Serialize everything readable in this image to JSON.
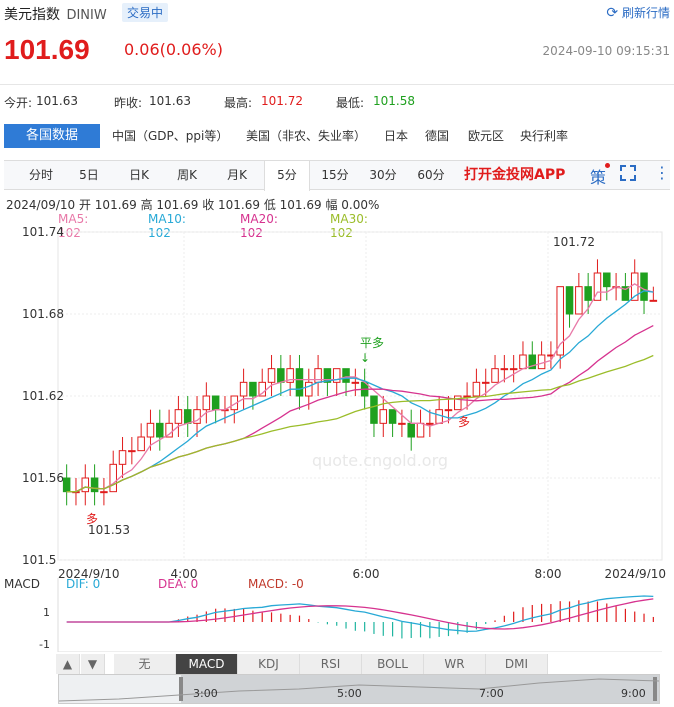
{
  "header": {
    "title": "美元指数",
    "code": "DINIW",
    "status": "交易中",
    "refresh_label": "刷新行情"
  },
  "quote": {
    "price": "101.69",
    "change": "0.06(0.06%)",
    "datetime": "2024-09-10 09:15:31"
  },
  "stats": {
    "open_label": "今开:",
    "open": "101.63",
    "prev_label": "昨收:",
    "prev": "101.63",
    "high_label": "最高:",
    "high": "101.72",
    "low_label": "最低:",
    "low": "101.58"
  },
  "data_tabs": {
    "active": "各国数据",
    "items": [
      "中国（GDP、ppi等）",
      "美国（非农、失业率）",
      "日本",
      "德国",
      "欧元区",
      "央行利率"
    ]
  },
  "period_tabs": {
    "items": [
      "分时",
      "5日",
      "日K",
      "周K",
      "月K",
      "5分",
      "15分",
      "30分",
      "60分"
    ],
    "active_index": 5,
    "app_link": "打开金投网APP",
    "ce_label": "策"
  },
  "info_line": "2024/09/10  开 101.69  高 101.69  收 101.69  低 101.69  幅 0.00%",
  "ma_legend": [
    {
      "label": "MA5: 102",
      "color": "#e879a8"
    },
    {
      "label": "MA10: 102",
      "color": "#28a9d6"
    },
    {
      "label": "MA20: 102",
      "color": "#d6338f"
    },
    {
      "label": "MA30: 102",
      "color": "#9bbd2a"
    }
  ],
  "watermark": "quote.cngold.org",
  "annotations": {
    "high_label": "101.72",
    "low_label": "101.53",
    "flat_long": "平多",
    "long1": "多",
    "long2": "多"
  },
  "macd": {
    "label": "MACD",
    "dif": "DIF: 0",
    "dea": "DEA: 0",
    "macd": "MACD: -0",
    "ticks": [
      "1",
      "-1"
    ]
  },
  "bottom_tabs": {
    "up": "▲",
    "down": "▼",
    "items": [
      "无",
      "MACD",
      "KDJ",
      "RSI",
      "BOLL",
      "WR",
      "DMI"
    ],
    "active_index": 1
  },
  "navigator": {
    "ticks": [
      "3:00",
      "5:00",
      "7:00",
      "9:00"
    ]
  },
  "colors": {
    "up": "#e01c1c",
    "down": "#1fa01f",
    "accent": "#2f7bd6"
  },
  "chart_data": {
    "type": "candlestick",
    "y_ticks": [
      "101.74",
      "101.68",
      "101.62",
      "101.56",
      "101.5"
    ],
    "ylim": [
      101.5,
      101.74
    ],
    "x_ticks": [
      "2024/9/10",
      "4:00",
      "6:00",
      "8:00",
      "2024/9/10"
    ],
    "candles": [
      [
        101.56,
        101.55,
        101.57,
        101.54
      ],
      [
        101.55,
        101.55,
        101.56,
        101.54
      ],
      [
        101.55,
        101.56,
        101.57,
        101.54
      ],
      [
        101.56,
        101.55,
        101.57,
        101.54
      ],
      [
        101.55,
        101.55,
        101.56,
        101.54
      ],
      [
        101.55,
        101.57,
        101.58,
        101.55
      ],
      [
        101.57,
        101.58,
        101.59,
        101.56
      ],
      [
        101.58,
        101.58,
        101.59,
        101.57
      ],
      [
        101.58,
        101.59,
        101.6,
        101.58
      ],
      [
        101.59,
        101.6,
        101.61,
        101.58
      ],
      [
        101.6,
        101.59,
        101.61,
        101.58
      ],
      [
        101.59,
        101.6,
        101.61,
        101.59
      ],
      [
        101.6,
        101.61,
        101.62,
        101.59
      ],
      [
        101.61,
        101.6,
        101.62,
        101.59
      ],
      [
        101.6,
        101.61,
        101.62,
        101.59
      ],
      [
        101.61,
        101.62,
        101.63,
        101.6
      ],
      [
        101.62,
        101.61,
        101.62,
        101.6
      ],
      [
        101.61,
        101.61,
        101.62,
        101.6
      ],
      [
        101.61,
        101.62,
        101.62,
        101.6
      ],
      [
        101.62,
        101.63,
        101.64,
        101.61
      ],
      [
        101.63,
        101.62,
        101.63,
        101.61
      ],
      [
        101.62,
        101.63,
        101.64,
        101.62
      ],
      [
        101.63,
        101.64,
        101.65,
        101.62
      ],
      [
        101.64,
        101.63,
        101.65,
        101.62
      ],
      [
        101.63,
        101.64,
        101.65,
        101.62
      ],
      [
        101.64,
        101.62,
        101.65,
        101.61
      ],
      [
        101.62,
        101.63,
        101.64,
        101.61
      ],
      [
        101.63,
        101.64,
        101.65,
        101.62
      ],
      [
        101.64,
        101.63,
        101.64,
        101.62
      ],
      [
        101.63,
        101.64,
        101.64,
        101.62
      ],
      [
        101.64,
        101.63,
        101.64,
        101.62
      ],
      [
        101.63,
        101.63,
        101.64,
        101.62
      ],
      [
        101.63,
        101.62,
        101.64,
        101.61
      ],
      [
        101.62,
        101.6,
        101.62,
        101.59
      ],
      [
        101.6,
        101.61,
        101.62,
        101.59
      ],
      [
        101.61,
        101.6,
        101.61,
        101.59
      ],
      [
        101.6,
        101.6,
        101.61,
        101.59
      ],
      [
        101.6,
        101.59,
        101.61,
        101.58
      ],
      [
        101.59,
        101.6,
        101.61,
        101.59
      ],
      [
        101.6,
        101.6,
        101.61,
        101.59
      ],
      [
        101.6,
        101.61,
        101.62,
        101.6
      ],
      [
        101.61,
        101.61,
        101.62,
        101.6
      ],
      [
        101.61,
        101.62,
        101.62,
        101.61
      ],
      [
        101.62,
        101.62,
        101.63,
        101.61
      ],
      [
        101.62,
        101.63,
        101.64,
        101.62
      ],
      [
        101.63,
        101.63,
        101.64,
        101.62
      ],
      [
        101.63,
        101.64,
        101.65,
        101.63
      ],
      [
        101.64,
        101.64,
        101.65,
        101.63
      ],
      [
        101.64,
        101.64,
        101.65,
        101.63
      ],
      [
        101.64,
        101.65,
        101.66,
        101.64
      ],
      [
        101.65,
        101.64,
        101.66,
        101.64
      ],
      [
        101.64,
        101.65,
        101.66,
        101.64
      ],
      [
        101.65,
        101.65,
        101.66,
        101.64
      ],
      [
        101.65,
        101.7,
        101.7,
        101.64
      ],
      [
        101.7,
        101.68,
        101.7,
        101.67
      ],
      [
        101.68,
        101.7,
        101.71,
        101.68
      ],
      [
        101.7,
        101.69,
        101.71,
        101.68
      ],
      [
        101.69,
        101.71,
        101.72,
        101.69
      ],
      [
        101.71,
        101.7,
        101.71,
        101.69
      ],
      [
        101.7,
        101.7,
        101.71,
        101.69
      ],
      [
        101.7,
        101.69,
        101.71,
        101.69
      ],
      [
        101.69,
        101.71,
        101.72,
        101.69
      ],
      [
        101.71,
        101.69,
        101.71,
        101.68
      ],
      [
        101.69,
        101.69,
        101.7,
        101.69
      ]
    ]
  }
}
